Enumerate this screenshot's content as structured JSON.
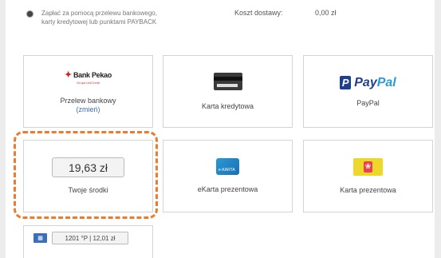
{
  "payment_note": {
    "line1": "Zapłać za pomocą przelewu bankowego,",
    "line2": "karty kredytowej lub punktami PAYBACK"
  },
  "shipping": {
    "label": "Koszt dostawy:",
    "value": "0,00 zł"
  },
  "tiles": [
    {
      "label": "Przelew bankowy",
      "link": "(zmień)",
      "logo_text": "Bank Pekao",
      "logo_sub": "Grupa UniCredit",
      "icon": "bank-pekao-logo"
    },
    {
      "label": "Karta kredytowa",
      "icon": "credit-card-icon"
    },
    {
      "label": "PayPal",
      "logo_pay": "Pay",
      "logo_pal": "Pal",
      "logo_mark": "P",
      "icon": "paypal-logo"
    },
    {
      "label": "Twoje środki",
      "amount": "19,63 zł",
      "selected": true
    },
    {
      "label": "eKarta prezentowa",
      "icon_text": "e-KARTA",
      "icon": "ekarta-icon"
    },
    {
      "label": "Karta prezentowa",
      "icon": "gift-card-icon"
    }
  ],
  "partial_tile": {
    "value": "1201 °P | 12,01 zł",
    "icon": "payback-card-icon"
  },
  "colors": {
    "highlight": "#ee7a2a",
    "link": "#3a6fb5",
    "paypal_dark": "#1f3f8c",
    "paypal_light": "#2b9bd8"
  }
}
